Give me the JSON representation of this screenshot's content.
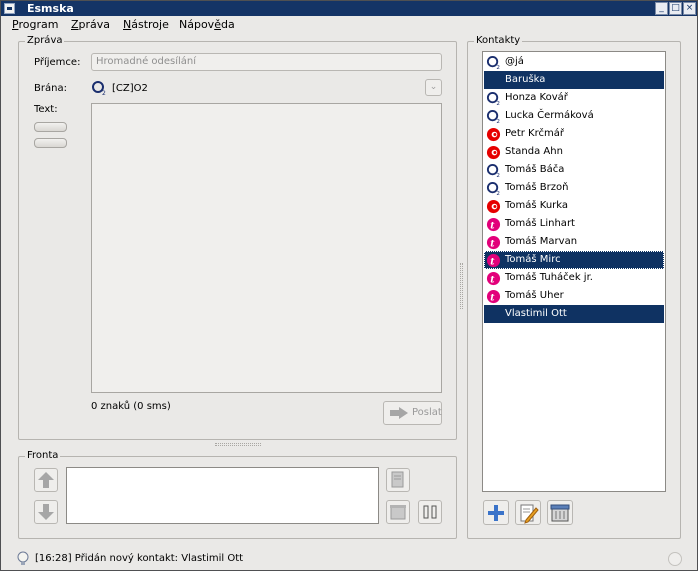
{
  "window": {
    "title": "Esmska"
  },
  "menu": [
    {
      "label": "Program",
      "ul": "P",
      "rest": "rogram"
    },
    {
      "label": "Zpráva",
      "ul": "Z",
      "rest": "práva"
    },
    {
      "label": "Nástroje",
      "ul": "N",
      "rest": "ástroje"
    },
    {
      "label": "Nápověda",
      "pre": "Nápov",
      "ul": "ě",
      "rest": "da"
    }
  ],
  "message": {
    "legend": "Zpráva",
    "recipient_label": "Příjemce:",
    "recipient_value": "Hromadné odesílání",
    "gateway_label": "Brána:",
    "gateway_value": "[CZ]O2",
    "text_label": "Text:",
    "counter": "0 znaků (0 sms)",
    "send_label": "Poslat"
  },
  "queue": {
    "legend": "Fronta"
  },
  "contacts": {
    "legend": "Kontakty",
    "items": [
      {
        "name": "@já",
        "op": "o2"
      },
      {
        "name": "Baruška",
        "op": "none",
        "selected": true
      },
      {
        "name": "Honza Kovář",
        "op": "o2"
      },
      {
        "name": "Lucka Čermáková",
        "op": "o2"
      },
      {
        "name": "Petr Krčmář",
        "op": "vodafone"
      },
      {
        "name": "Standa Ahn",
        "op": "vodafone"
      },
      {
        "name": "Tomáš Báča",
        "op": "o2"
      },
      {
        "name": "Tomáš Brzoň",
        "op": "o2"
      },
      {
        "name": "Tomáš Kurka",
        "op": "vodafone"
      },
      {
        "name": "Tomáš Linhart",
        "op": "tmobile"
      },
      {
        "name": "Tomáš Marvan",
        "op": "tmobile"
      },
      {
        "name": "Tomáš Mirc",
        "op": "tmobile",
        "selected": true,
        "focus": true
      },
      {
        "name": "Tomáš Tuháček jr.",
        "op": "tmobile"
      },
      {
        "name": "Tomáš Uher",
        "op": "tmobile"
      },
      {
        "name": "Vlastimil Ott",
        "op": "none",
        "selected": true
      }
    ]
  },
  "status": {
    "text": "[16:28] Přidán nový kontakt: Vlastimil Ott"
  },
  "colors": {
    "title_bar": "#143466",
    "selection": "#0f3262",
    "tmobile": "#e2007a",
    "vodafone": "#e60000",
    "o2": "#1a2e6e"
  }
}
